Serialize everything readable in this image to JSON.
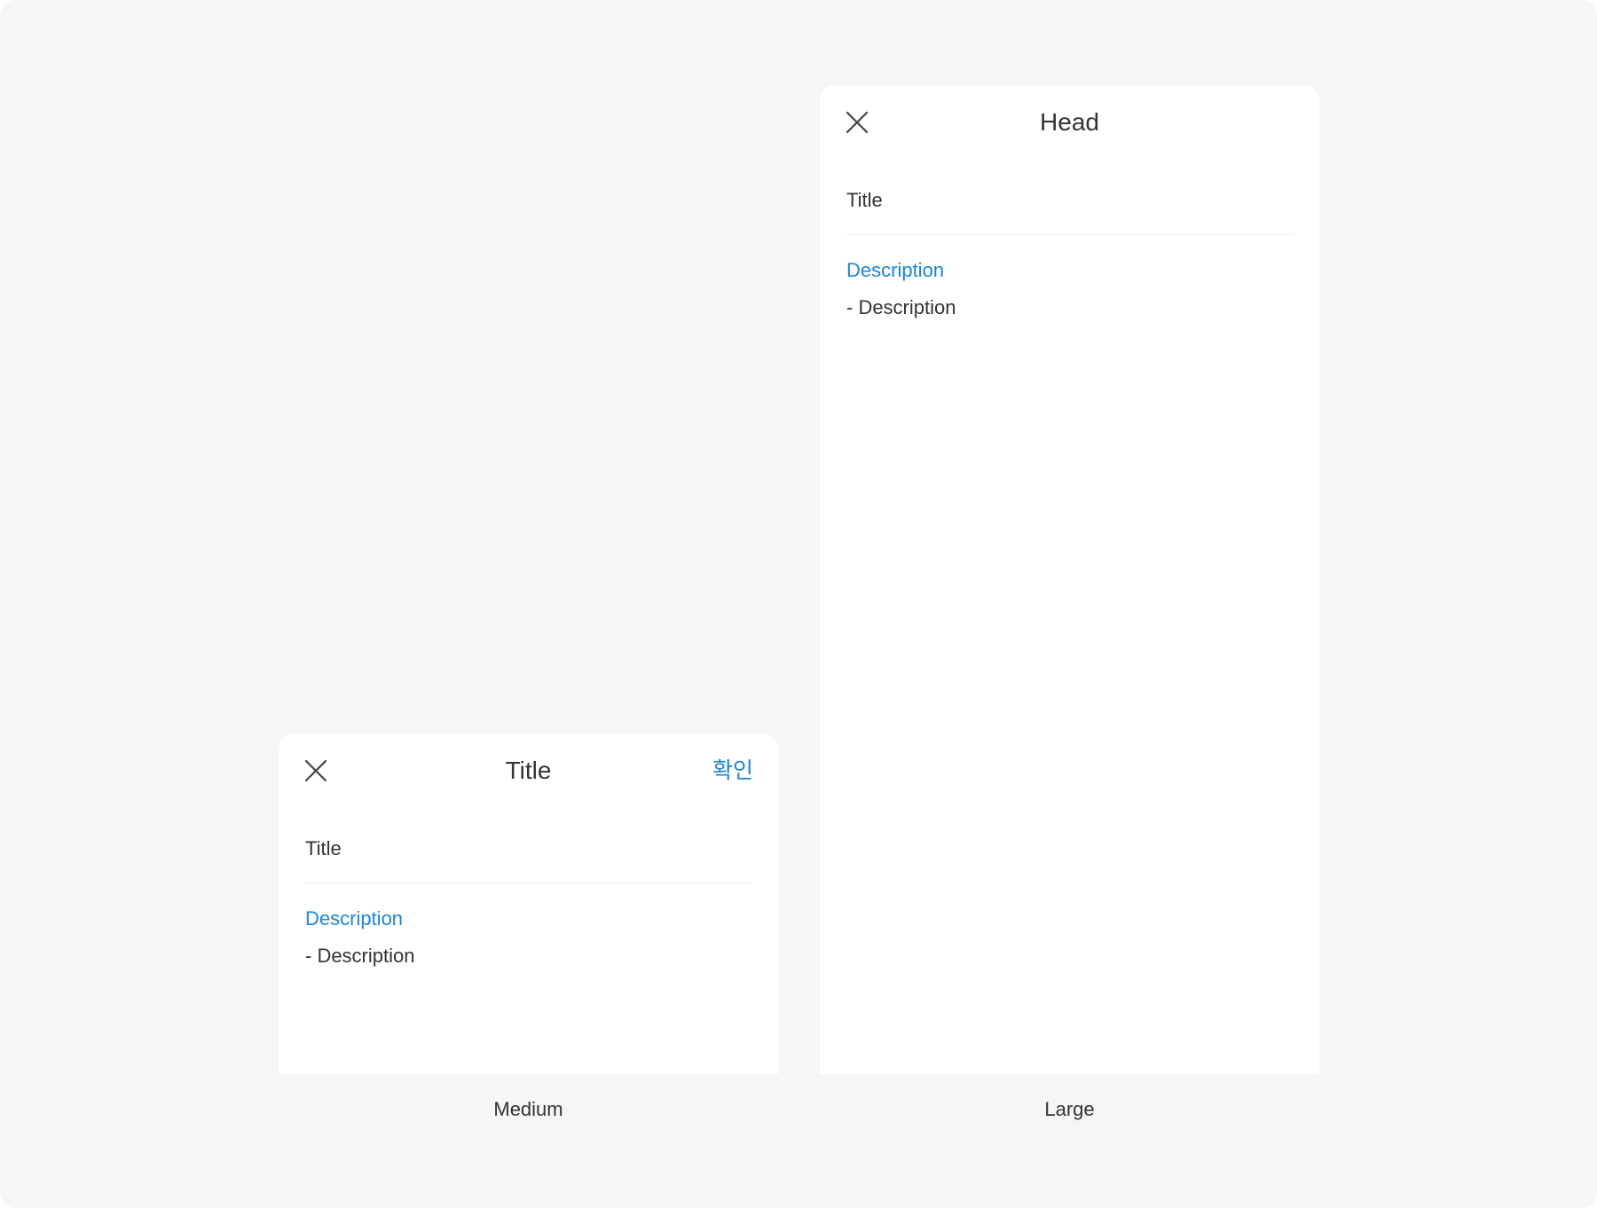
{
  "colors": {
    "background": "#f6f6f6",
    "sheet": "#ffffff",
    "accent": "#1a86d9",
    "text": "#333333",
    "divider": "#eeeeee"
  },
  "medium": {
    "header": {
      "close_icon": "close-icon",
      "title": "Title",
      "confirm_label": "확인"
    },
    "field_label": "Title",
    "description_heading": "Description",
    "description_body": "- Description",
    "caption": "Medium"
  },
  "large": {
    "header": {
      "close_icon": "close-icon",
      "title": "Head"
    },
    "field_label": "Title",
    "description_heading": "Description",
    "description_body": "- Description",
    "caption": "Large"
  }
}
